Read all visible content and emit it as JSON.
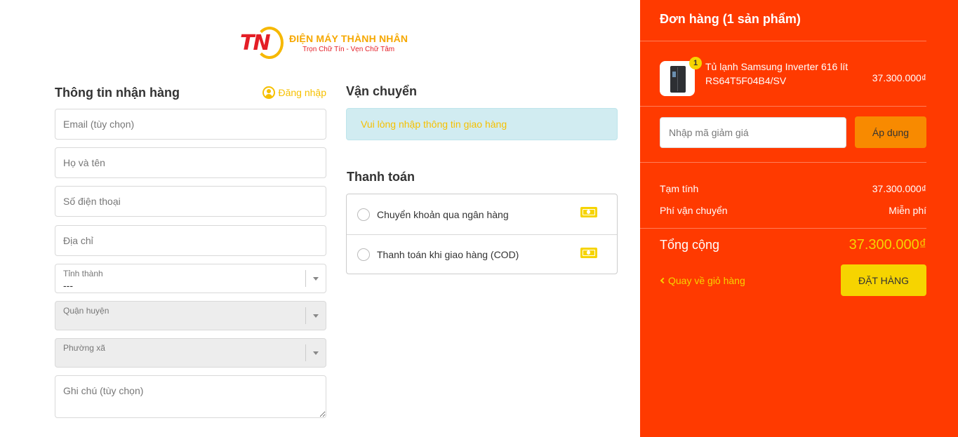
{
  "logo": {
    "mark": "TN",
    "brand": "ĐIỆN MÁY THÀNH NHÂN",
    "slogan": "Trọn Chữ Tín - Vẹn Chữ Tâm"
  },
  "info": {
    "title": "Thông tin nhận hàng",
    "login_label": "Đăng nhập",
    "email_placeholder": "Email (tùy chọn)",
    "name_placeholder": "Họ và tên",
    "phone_placeholder": "Số điện thoại",
    "address_placeholder": "Địa chỉ",
    "province": {
      "label": "Tỉnh thành",
      "value": "---"
    },
    "district": {
      "label": "Quận huyện"
    },
    "ward": {
      "label": "Phường xã"
    },
    "note_placeholder": "Ghi chú (tùy chọn)"
  },
  "shipping": {
    "title": "Vận chuyển",
    "notice": "Vui lòng nhập thông tin giao hàng"
  },
  "payment": {
    "title": "Thanh toán",
    "options": [
      {
        "label": "Chuyển khoản qua ngân hàng",
        "icon": "cash-icon"
      },
      {
        "label": "Thanh toán khi giao hàng (COD)",
        "icon": "cash-icon"
      }
    ]
  },
  "order": {
    "title": "Đơn hàng (1 sản phẩm)",
    "item": {
      "quantity": "1",
      "name": "Tủ lạnh Samsung Inverter 616 lít RS64T5F04B4/SV",
      "price": "37.300.000₫"
    },
    "coupon_placeholder": "Nhập mã giảm giá",
    "apply_label": "Áp dụng",
    "subtotal_label": "Tạm tính",
    "subtotal_value": "37.300.000₫",
    "shipping_label": "Phí vận chuyển",
    "shipping_value": "Miễn phí",
    "total_label": "Tổng cộng",
    "total_value": "37.300.000₫",
    "back_label": "Quay về giỏ hàng",
    "submit_label": "ĐẶT HÀNG"
  },
  "colors": {
    "panel": "#ff3a00",
    "accent": "#f6d400",
    "apply_button": "#f88a00"
  }
}
